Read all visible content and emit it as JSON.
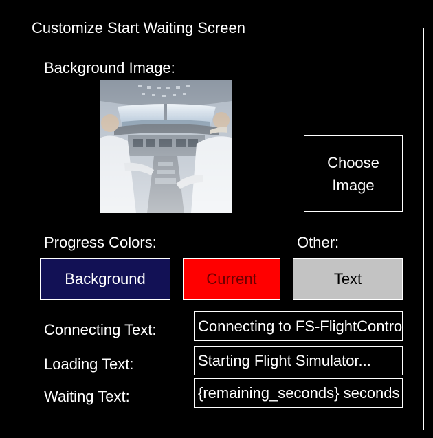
{
  "group": {
    "title": "Customize Start Waiting Screen"
  },
  "background_image": {
    "label": "Background Image:",
    "preview_icon": "cockpit-photo",
    "choose_button": "Choose\nImage"
  },
  "progress_colors": {
    "label": "Progress Colors:",
    "background_button": "Background",
    "background_color": "#121155",
    "current_button": "Current",
    "current_color": "#ff0000"
  },
  "other": {
    "label": "Other:",
    "text_button": "Text",
    "text_color": "#c3c3c3"
  },
  "texts": {
    "connecting_label": "Connecting Text:",
    "connecting_value": "Connecting to FS-FlightControl...",
    "loading_label": "Loading Text:",
    "loading_value": "Starting Flight Simulator...",
    "waiting_label": "Waiting Text:",
    "waiting_value": "{remaining_seconds} seconds"
  }
}
